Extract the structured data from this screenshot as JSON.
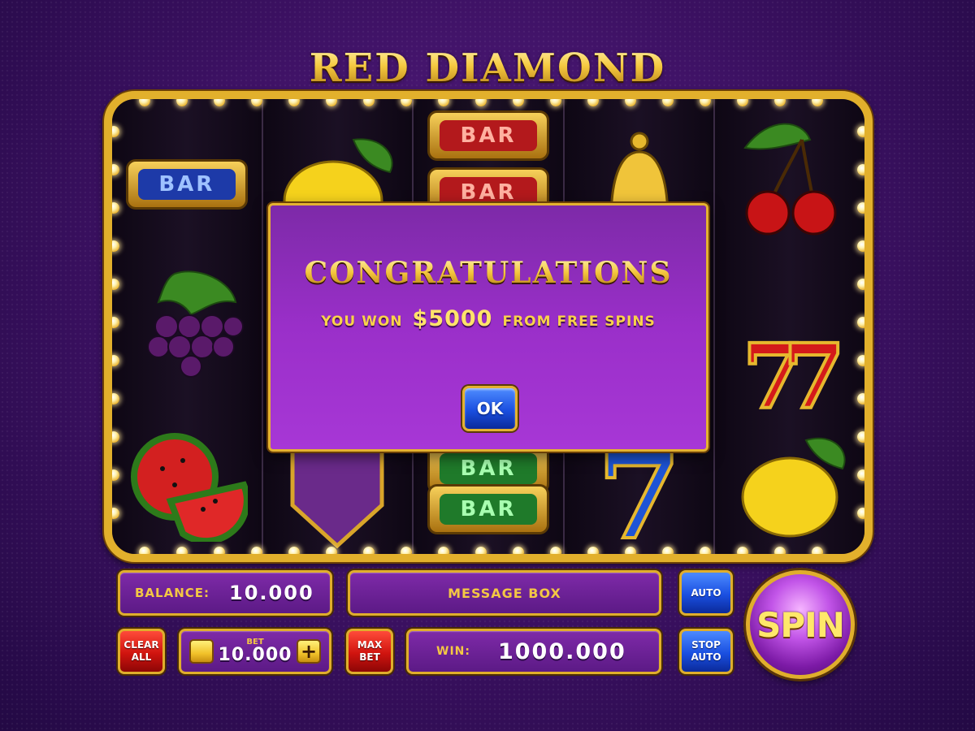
{
  "game": {
    "title": "RED DIAMOND"
  },
  "reels": [
    [
      "bar-blue-icon",
      "grapes-icon",
      "watermelon-icon"
    ],
    [
      "lemon-icon",
      "lucky-wild-icon"
    ],
    [
      "bar-red-icon",
      "bar-red-icon",
      "bar-green-icon",
      "bar-green-icon"
    ],
    [
      "bell-icon",
      "seven-blue-icon"
    ],
    [
      "cherries-icon",
      "seven-red-icon",
      "lemon-icon"
    ]
  ],
  "reel_labels": {
    "bar": "BAR",
    "seven": "7"
  },
  "dialog": {
    "title": "CONGRATULATIONS",
    "message_prefix": "YOU WON",
    "amount": "$5000",
    "message_suffix": "FROM FREE SPINS",
    "ok_label": "OK"
  },
  "controls": {
    "balance_label": "BALANCE:",
    "balance_value": "10.000",
    "message_box": "MESSAGE BOX",
    "clear_all_label": "CLEAR ALL",
    "bet_label": "BET",
    "bet_value": "10.000",
    "bet_plus": "+",
    "max_bet_label": "MAX BET",
    "win_label": "WIN:",
    "win_value": "1000.000",
    "auto_label": "AUTO",
    "stop_auto_label": "STOP AUTO",
    "spin_label": "SPIN"
  },
  "colors": {
    "background": "#3a1060",
    "gold": "#e2b02c",
    "dialog_purple": "#9a2fc9",
    "button_blue": "#1a4fe0",
    "button_red": "#d0140f"
  }
}
